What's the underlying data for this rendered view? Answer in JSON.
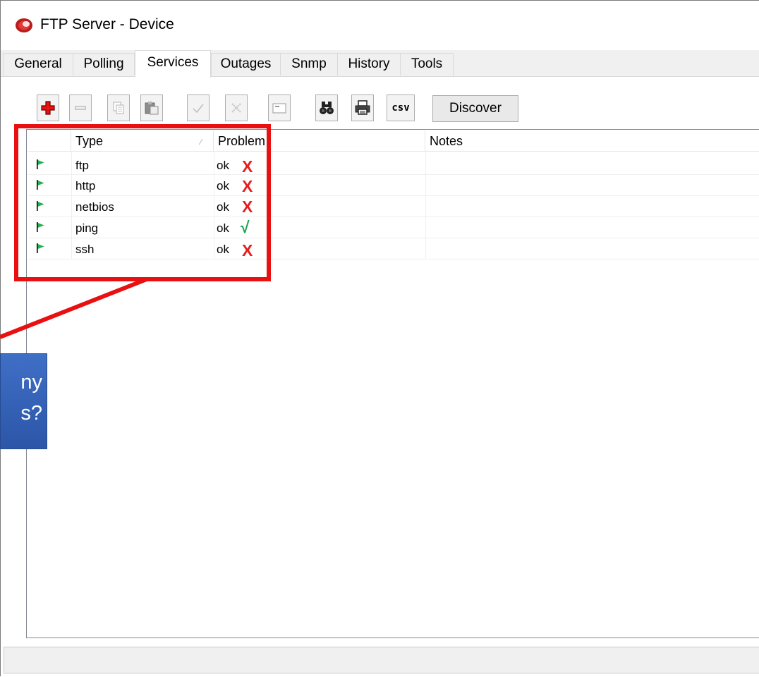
{
  "window": {
    "title": "FTP Server - Device"
  },
  "tabs": [
    {
      "label": "General"
    },
    {
      "label": "Polling"
    },
    {
      "label": "Services",
      "active": true
    },
    {
      "label": "Outages"
    },
    {
      "label": "Snmp"
    },
    {
      "label": "History"
    },
    {
      "label": "Tools"
    }
  ],
  "toolbar": {
    "buttons": [
      {
        "icon": "add-icon",
        "enabled": true
      },
      {
        "icon": "remove-icon",
        "enabled": false
      },
      {
        "icon": "copy-icon",
        "enabled": false
      },
      {
        "icon": "paste-icon",
        "enabled": false
      },
      {
        "icon": "check-icon",
        "enabled": false
      },
      {
        "icon": "cancel-icon",
        "enabled": false
      },
      {
        "icon": "window-icon",
        "enabled": false
      },
      {
        "icon": "binoculars-icon",
        "enabled": true
      },
      {
        "icon": "print-icon",
        "enabled": true
      },
      {
        "icon": "csv-icon",
        "enabled": true,
        "label": "csv"
      }
    ],
    "discover_label": "Discover"
  },
  "table": {
    "columns": [
      "Type",
      "Problem",
      "Notes"
    ],
    "rows": [
      {
        "type": "ftp",
        "problem": "ok",
        "mark": "X",
        "notes": ""
      },
      {
        "type": "http",
        "problem": "ok",
        "mark": "X",
        "notes": ""
      },
      {
        "type": "netbios",
        "problem": "ok",
        "mark": "X",
        "notes": ""
      },
      {
        "type": "ping",
        "problem": "ok",
        "mark": "√",
        "notes": ""
      },
      {
        "type": "ssh",
        "problem": "ok",
        "mark": "X",
        "notes": ""
      }
    ]
  },
  "annotation": {
    "callout_line1": "ny",
    "callout_line2": "s?"
  },
  "colors": {
    "highlight": "#e81010",
    "mark_fail": "#e81c1c",
    "mark_ok": "#16a34a",
    "flag": "#22b14c",
    "callout": "#3f6fc6"
  }
}
